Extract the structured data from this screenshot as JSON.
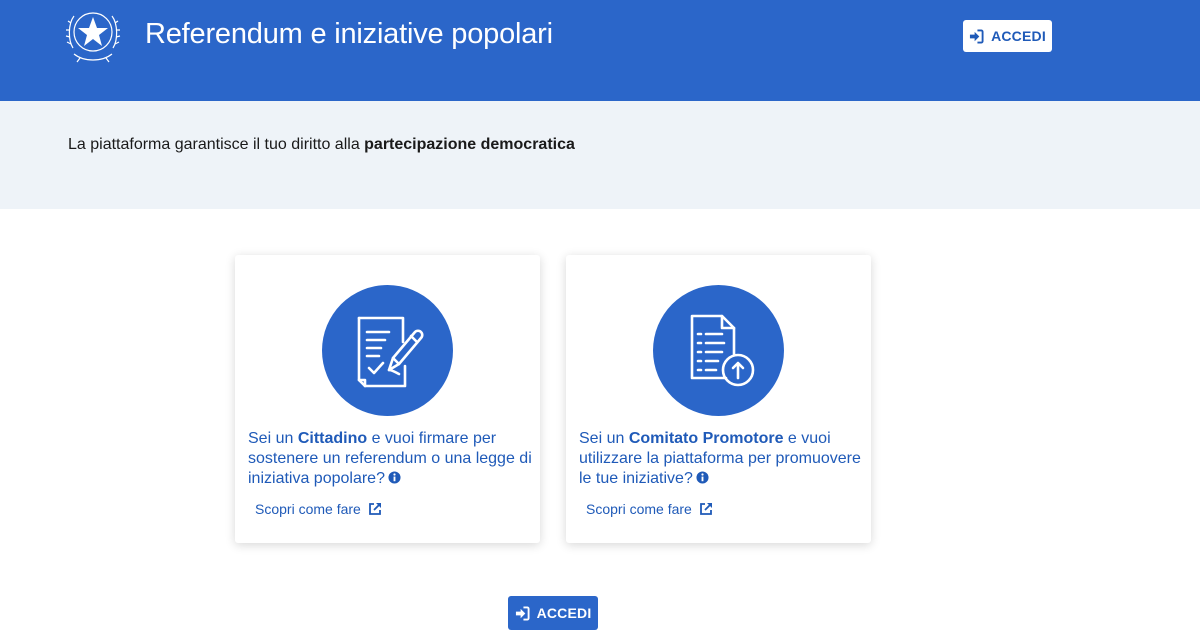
{
  "header": {
    "title": "Referendum e iniziative popolari",
    "login_label": "ACCEDI",
    "emblem_icon": "italian-republic-emblem-icon",
    "background": "#2b66c9"
  },
  "intro": {
    "text_prefix": "La piattaforma garantisce il tuo diritto alla ",
    "text_bold": "partecipazione democratica",
    "background": "#eef3f8"
  },
  "cards": [
    {
      "icon": "sign-document-icon",
      "text_prefix": "Sei un ",
      "text_bold": "Cittadino",
      "text_suffix": " e vuoi firmare per sostenere un referendum o una legge di iniziativa popolare?",
      "link_label": "Scopri come fare",
      "link_icon": "external-link-icon",
      "info_icon": "info-icon"
    },
    {
      "icon": "upload-document-icon",
      "text_prefix": "Sei un ",
      "text_bold": "Comitato Promotore",
      "text_suffix": " e vuoi utilizzare la piattaforma per promuovere le tue iniziative?",
      "link_label": "Scopri come fare",
      "link_icon": "external-link-icon",
      "info_icon": "info-icon"
    }
  ],
  "main": {
    "login_label": "ACCEDI",
    "login_icon": "sign-in-icon"
  },
  "colors": {
    "accent": "#2b66c9",
    "link": "#1f5ab8"
  }
}
